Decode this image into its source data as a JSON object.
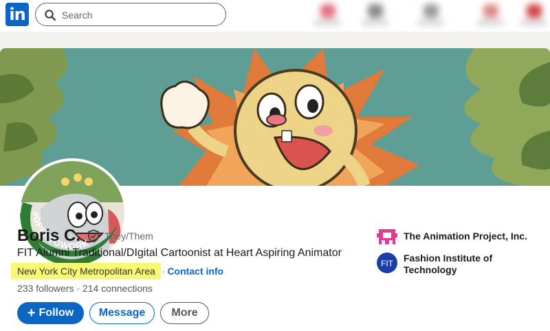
{
  "topbar": {
    "logo_text": "in",
    "search_placeholder": "Search",
    "brand_color": "#0a66c2"
  },
  "profile": {
    "name": "Boris C.",
    "pronouns": "They/Them",
    "badge_text": "#OPENTOWORK",
    "headline": "FIT Alumni Traditional/DIgital Cartoonist at Heart Aspiring Animator",
    "location": "New York City Metropolitan Area",
    "location_separator": "·",
    "contact_label": "Contact info",
    "stats": "233 followers · 214 connections"
  },
  "actions": {
    "follow_label": "Follow",
    "message_label": "Message",
    "more_label": "More"
  },
  "experience": [
    {
      "name": "The Animation Project, Inc.",
      "logo_icon": "animation-project-logo",
      "color": "#e33b8f"
    },
    {
      "name": "Fashion Institute of Technology",
      "logo_icon": "fit-logo",
      "logo_text": "FIT",
      "color": "#1a3ea8"
    }
  ],
  "colors": {
    "highlight": "#f9f872",
    "open_to_work_green": "#2e7d32"
  }
}
